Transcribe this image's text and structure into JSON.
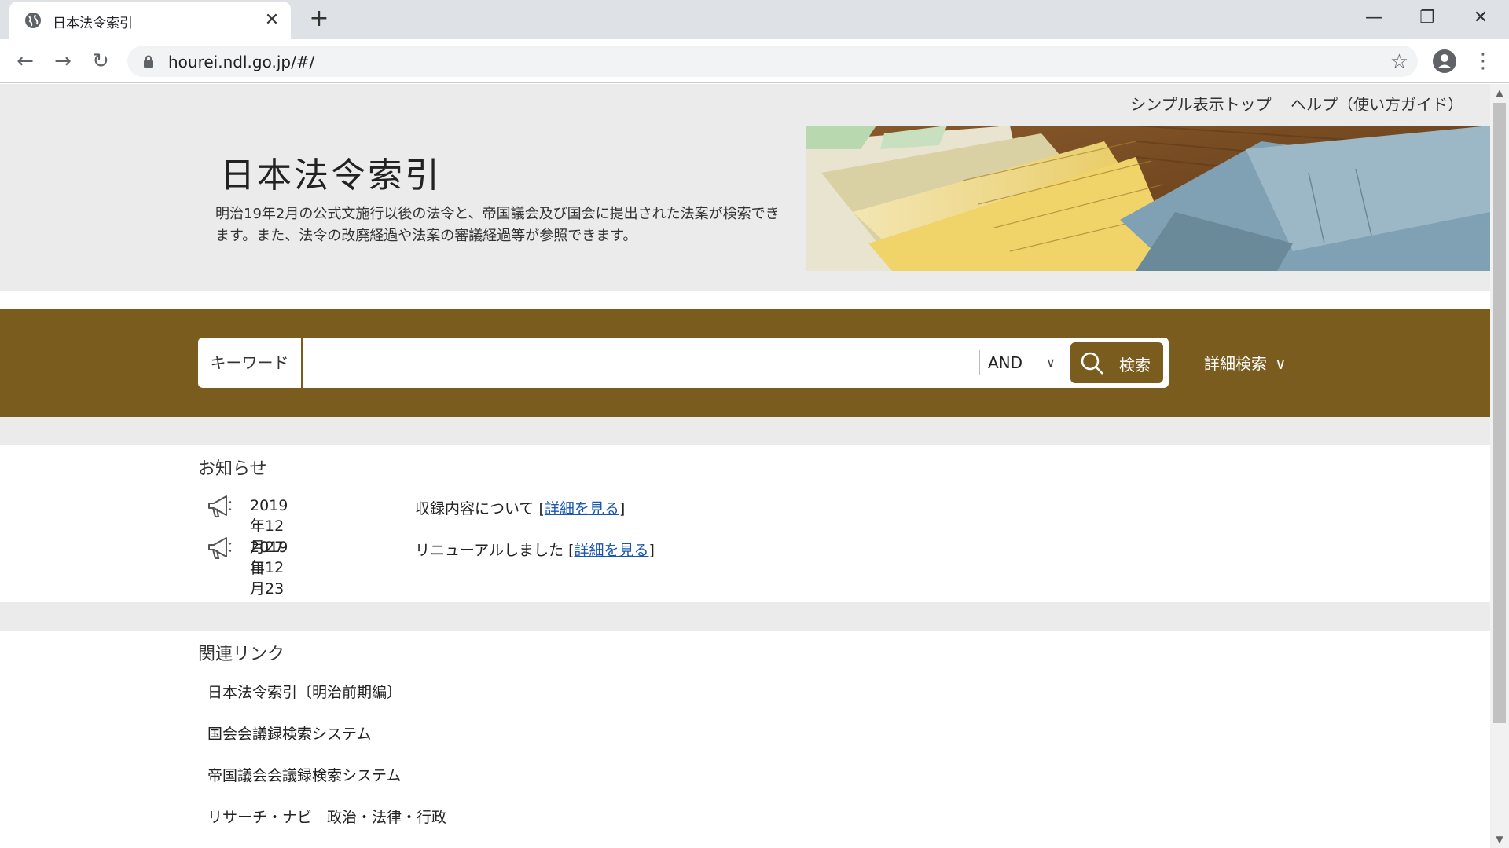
{
  "browser": {
    "tab_title": "日本法令索引",
    "url": "hourei.ndl.go.jp/#/",
    "close_tab": "✕",
    "new_tab": "+",
    "minimize": "—",
    "restore": "❐",
    "close_window": "✕"
  },
  "header": {
    "top_links": [
      "シンプル表示トップ",
      "ヘルプ（使い方ガイド）"
    ],
    "title": "日本法令索引",
    "description": "明治19年2月の公式文施行以後の法令と、帝国議会及び国会に提出された法案が検索できます。また、法令の改廃経過や法案の審議経過等が参照できます。"
  },
  "search": {
    "keyword_label": "キーワード",
    "input_value": "",
    "operator": "AND",
    "button_label": "検索",
    "advanced_label": "詳細検索"
  },
  "news": {
    "heading": "お知らせ",
    "items": [
      {
        "date": "2019年12月27日",
        "text": "収録内容について ",
        "link": "詳細を見る"
      },
      {
        "date": "2019年12月23日",
        "text": "リニューアルしました ",
        "link": "詳細を見る"
      }
    ]
  },
  "related": {
    "heading": "関連リンク",
    "items": [
      "日本法令索引〔明治前期編〕",
      "国会会議録検索システム",
      "帝国議会会議録検索システム",
      "リサーチ・ナビ　政治・法律・行政"
    ]
  },
  "colors": {
    "accent": "#7a5c1f",
    "link": "#1a57b0",
    "band_bg": "#ebebeb"
  }
}
